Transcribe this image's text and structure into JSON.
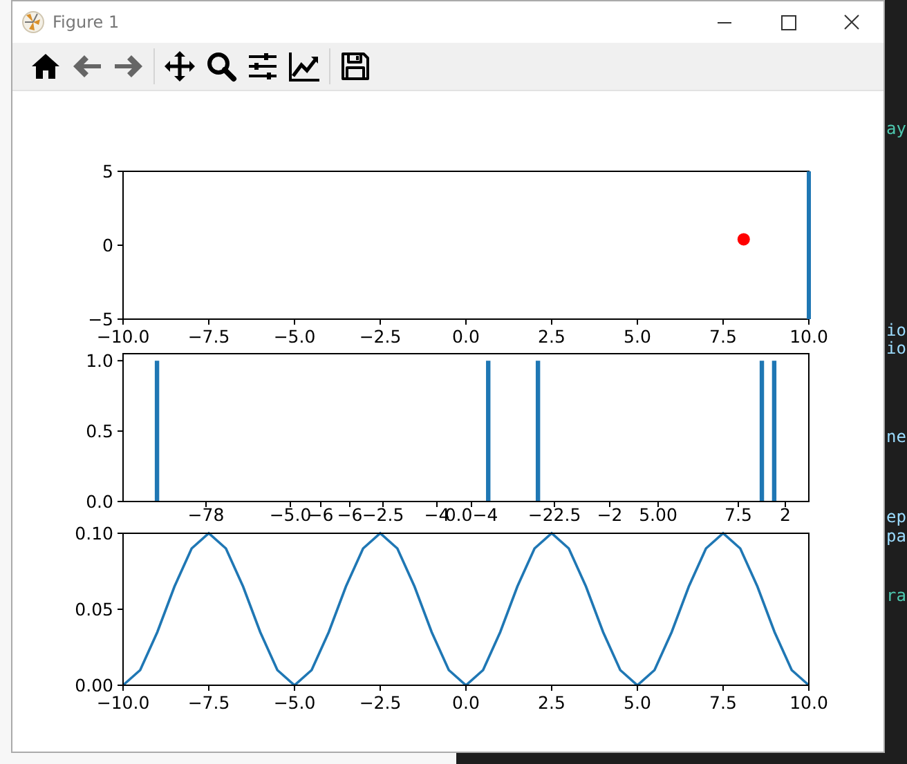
{
  "window": {
    "title": "Figure 1"
  },
  "toolbar": [
    {
      "kind": "home",
      "disabled": false
    },
    {
      "kind": "back",
      "disabled": true
    },
    {
      "kind": "forward",
      "disabled": true
    },
    {
      "kind": "separator"
    },
    {
      "kind": "pan",
      "disabled": false
    },
    {
      "kind": "zoom",
      "disabled": false
    },
    {
      "kind": "subplots",
      "disabled": false
    },
    {
      "kind": "lines",
      "disabled": false
    },
    {
      "kind": "separator"
    },
    {
      "kind": "save",
      "disabled": false
    }
  ],
  "plots": [
    {
      "chart_data": {
        "type": "scatter",
        "xlim": [
          -10,
          10
        ],
        "ylim": [
          -5,
          5
        ],
        "xticks": [
          {
            "value": -10,
            "label": "−10.0"
          },
          {
            "value": -7.5,
            "label": "−7.5"
          },
          {
            "value": -5,
            "label": "−5.0"
          },
          {
            "value": -2.5,
            "label": "−2.5"
          },
          {
            "value": 0,
            "label": "0.0"
          },
          {
            "value": 2.5,
            "label": "2.5"
          },
          {
            "value": 5,
            "label": "5.0"
          },
          {
            "value": 7.5,
            "label": "7.5"
          },
          {
            "value": 10,
            "label": "10.0"
          }
        ],
        "yticks": [
          {
            "value": -5,
            "label": "−5"
          },
          {
            "value": 0,
            "label": "0"
          },
          {
            "value": 5,
            "label": "5"
          }
        ],
        "series": [
          {
            "color": "#ff0000",
            "x": [
              8.1
            ],
            "values": [
              0.4
            ]
          }
        ],
        "ref_lines": [
          {
            "axis": "x",
            "value": 10,
            "color": "#1f77b4"
          }
        ]
      }
    },
    {
      "chart_data": {
        "type": "bar",
        "xlim": [
          -10,
          10
        ],
        "ylim": [
          0,
          1.05
        ],
        "yticks": [
          {
            "value": 0,
            "label": "0.0"
          },
          {
            "value": 0.5,
            "label": "0.5"
          },
          {
            "value": 1,
            "label": "1.0"
          }
        ],
        "series": [
          {
            "color": "#1f77b4",
            "x": [
              -9.01,
              0.65,
              2.1,
              8.63,
              8.99
            ],
            "values": [
              1,
              1,
              1,
              1,
              1
            ]
          }
        ]
      },
      "overlapping_tick_labels": [
        "−78",
        "−5.0",
        "−6",
        "−6",
        "−2.5",
        "−4",
        "0.0−4",
        "−22.5",
        "−2",
        "5.00",
        "7.5",
        "2"
      ]
    },
    {
      "chart_data": {
        "type": "line",
        "xlim": [
          -10,
          10
        ],
        "ylim": [
          0,
          0.1
        ],
        "xticks": [
          {
            "value": -10,
            "label": "−10.0"
          },
          {
            "value": -7.5,
            "label": "−7.5"
          },
          {
            "value": -5,
            "label": "−5.0"
          },
          {
            "value": -2.5,
            "label": "−2.5"
          },
          {
            "value": 0,
            "label": "0.0"
          },
          {
            "value": 2.5,
            "label": "2.5"
          },
          {
            "value": 5,
            "label": "5.0"
          },
          {
            "value": 7.5,
            "label": "7.5"
          },
          {
            "value": 10,
            "label": "10.0"
          }
        ],
        "yticks": [
          {
            "value": 0,
            "label": "0.00"
          },
          {
            "value": 0.05,
            "label": "0.05"
          },
          {
            "value": 0.1,
            "label": "0.10"
          }
        ],
        "series": [
          {
            "color": "#1f77b4",
            "x": [
              -10,
              -9.5,
              -9,
              -8.5,
              -8,
              -7.5,
              -7,
              -6.5,
              -6,
              -5.5,
              -5,
              -4.5,
              -4,
              -3.5,
              -3,
              -2.5,
              -2,
              -1.5,
              -1,
              -0.5,
              0,
              0.5,
              1,
              1.5,
              2,
              2.5,
              3,
              3.5,
              4,
              4.5,
              5,
              5.5,
              6,
              6.5,
              7,
              7.5,
              8,
              8.5,
              9,
              9.5,
              10
            ],
            "values": [
              0,
              0.01,
              0.035,
              0.065,
              0.09,
              0.1,
              0.09,
              0.065,
              0.035,
              0.01,
              0,
              0.01,
              0.035,
              0.065,
              0.09,
              0.1,
              0.09,
              0.065,
              0.035,
              0.01,
              0,
              0.01,
              0.035,
              0.065,
              0.09,
              0.1,
              0.09,
              0.065,
              0.035,
              0.01,
              0,
              0.01,
              0.035,
              0.065,
              0.09,
              0.1,
              0.09,
              0.065,
              0.035,
              0.01,
              0
            ]
          }
        ]
      }
    }
  ],
  "background_editor": {
    "lines": [
      {
        "text": "ay",
        "color": "#4ec9b0"
      },
      {
        "text": "io",
        "color": "#9cdcfe"
      },
      {
        "text": "io",
        "color": "#9cdcfe"
      },
      {
        "text": "ne",
        "color": "#9cdcfe"
      },
      {
        "text": "ep",
        "color": "#9cdcfe"
      },
      {
        "text": "pa",
        "color": "#9cdcfe"
      },
      {
        "text": "ra",
        "color": "#4ec9b0"
      }
    ]
  }
}
